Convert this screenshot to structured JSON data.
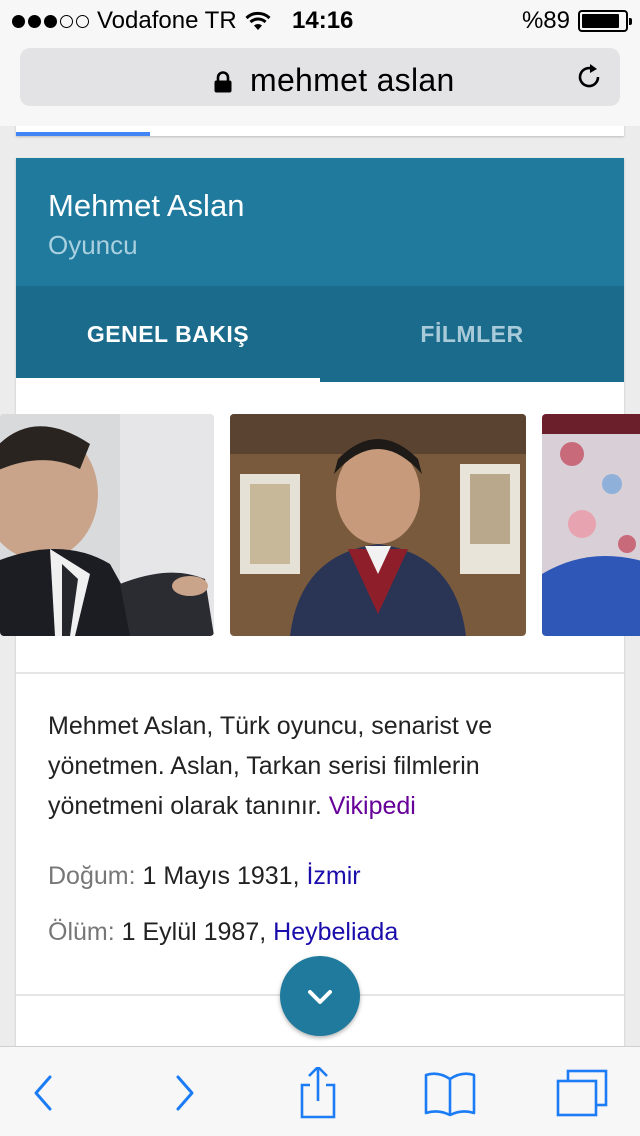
{
  "status_bar": {
    "carrier": "Vodafone TR",
    "time": "14:16",
    "battery_percent_text": "%89",
    "battery_level": 0.89,
    "signal_bars_filled": 3,
    "signal_bars_total": 5
  },
  "url_bar": {
    "address": "mehmet aslan"
  },
  "knowledge_card": {
    "title": "Mehmet Aslan",
    "subtitle": "Oyuncu",
    "tabs": [
      {
        "label": "GENEL BAKIŞ",
        "active": true
      },
      {
        "label": "FİLMLER",
        "active": false
      }
    ],
    "description": "Mehmet Aslan, Türk oyuncu, senarist ve yönetmen. Aslan, Tarkan serisi filmlerin yönetmeni olarak tanınır.",
    "description_link": "Vikipedi",
    "facts": [
      {
        "label": "Doğum:",
        "value": "1 Mayıs 1931, ",
        "link": "İzmir"
      },
      {
        "label": "Ölüm:",
        "value": "1 Eylül 1987, ",
        "link": "Heybeliada"
      }
    ]
  },
  "colors": {
    "header": "#1f7a9d",
    "tabs": "#1b6c8c",
    "link": "#1a0dab",
    "visited_link": "#660099",
    "ios_blue": "#1b7cf5"
  }
}
